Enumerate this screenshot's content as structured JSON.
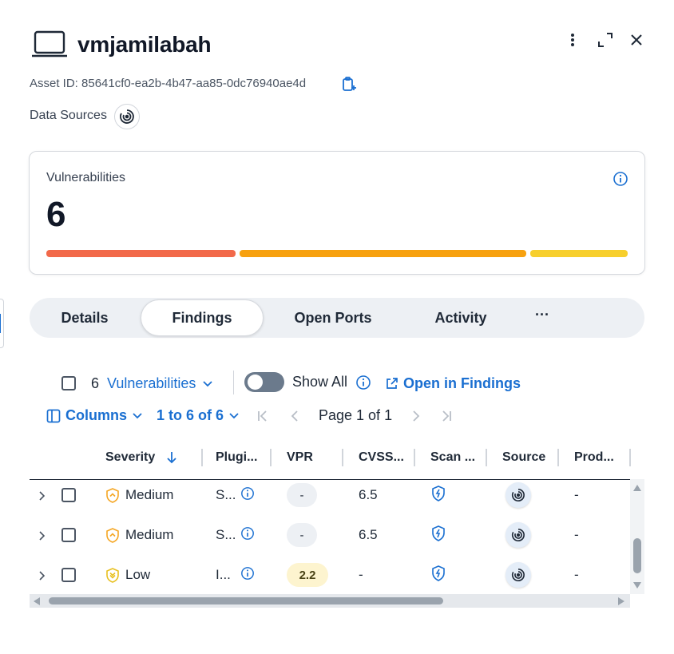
{
  "header": {
    "title": "vmjamilabah",
    "asset_id_text": "Asset ID: 85641cf0-ea2b-4b47-aa85-0dc76940ae4d",
    "data_sources_label": "Data Sources",
    "icons": [
      "laptop-icon",
      "more-vertical-icon",
      "expand-icon",
      "close-icon",
      "copy-icon",
      "data-source-icon"
    ]
  },
  "vulnerabilities": {
    "label": "Vulnerabilities",
    "count": "6",
    "bar_segments": [
      {
        "severity": "critical",
        "color": "#f2694a",
        "fraction": 0.33
      },
      {
        "severity": "high",
        "color": "#f7a10f",
        "fraction": 0.5
      },
      {
        "severity": "medium",
        "color": "#f7cf2d",
        "fraction": 0.17
      }
    ]
  },
  "tabs": [
    {
      "label": "Details",
      "active": false
    },
    {
      "label": "Findings",
      "active": true
    },
    {
      "label": "Open Ports",
      "active": false
    },
    {
      "label": "Activity",
      "active": false
    },
    {
      "label": "···",
      "active": false
    }
  ],
  "toolbar": {
    "selected_count": "6",
    "type_dropdown": "Vulnerabilities",
    "show_all_label": "Show All",
    "show_all_on": false,
    "open_in_findings": "Open in Findings",
    "columns_label": "Columns",
    "range_label": "1 to 6 of 6",
    "page_label": "Page 1 of 1"
  },
  "table": {
    "columns": [
      "Severity",
      "Plugi...",
      "VPR",
      "CVSS...",
      "Scan ...",
      "Source",
      "Prod..."
    ],
    "rows": [
      {
        "severity": "Medium",
        "plugin": "S...",
        "vpr": "-",
        "cvss": "6.5",
        "product": "-"
      },
      {
        "severity": "Medium",
        "plugin": "S...",
        "vpr": "-",
        "cvss": "6.5",
        "product": "-"
      },
      {
        "severity": "Low",
        "plugin": "I...",
        "vpr": "2.2",
        "cvss": "-",
        "product": "-"
      }
    ]
  },
  "colors": {
    "accent": "#1a6fd1",
    "medium_severity": "#f5a623",
    "low_severity": "#e8c020",
    "vpr_low_bg": "#fdf4cf"
  }
}
